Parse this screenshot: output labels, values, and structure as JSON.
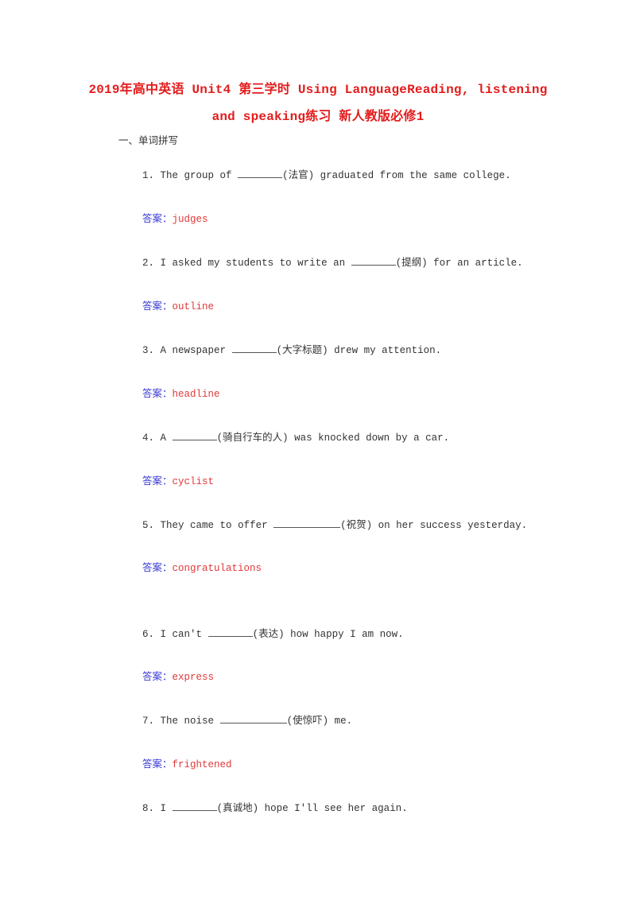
{
  "document": {
    "title_line1": "2019年高中英语 Unit4 第三学时 Using LanguageReading, listening",
    "title_line2": "and speaking练习 新人教版必修1",
    "section_heading": "一、单词拼写",
    "answer_label": "答案：",
    "colors": {
      "title": "#e31c1c",
      "answer_label": "#3a3ad6",
      "answer_value": "#e23838",
      "body_text": "#333333"
    },
    "questions": [
      {
        "number": "1.",
        "before": "The group of ",
        "hint": "(法官)",
        "after": " graduated from the same college.",
        "answer": "judges"
      },
      {
        "number": "2.",
        "before": "I asked my students to write an ",
        "hint": "(提纲)",
        "after": " for an article.",
        "answer": "outline"
      },
      {
        "number": "3.",
        "before": "A newspaper ",
        "hint": "(大字标题)",
        "after": " drew my attention.",
        "answer": "headline"
      },
      {
        "number": "4.",
        "before": "A ",
        "hint": "(骑自行车的人)",
        "after": " was knocked down by a car.",
        "answer": "cyclist"
      },
      {
        "number": "5.",
        "before": "They came to offer ",
        "hint": "(祝贺)",
        "after": " on her success yesterday.",
        "answer": "congratulations"
      },
      {
        "number": "6.",
        "before": "I can't ",
        "hint": "(表达)",
        "after": " how happy I am now.",
        "answer": "express"
      },
      {
        "number": "7.",
        "before": "The noise ",
        "hint": "(使惊吓)",
        "after": " me.",
        "answer": "frightened"
      },
      {
        "number": "8.",
        "before": "I ",
        "hint": "(真诚地)",
        "after": " hope I'll see her again.",
        "answer": null
      }
    ]
  }
}
